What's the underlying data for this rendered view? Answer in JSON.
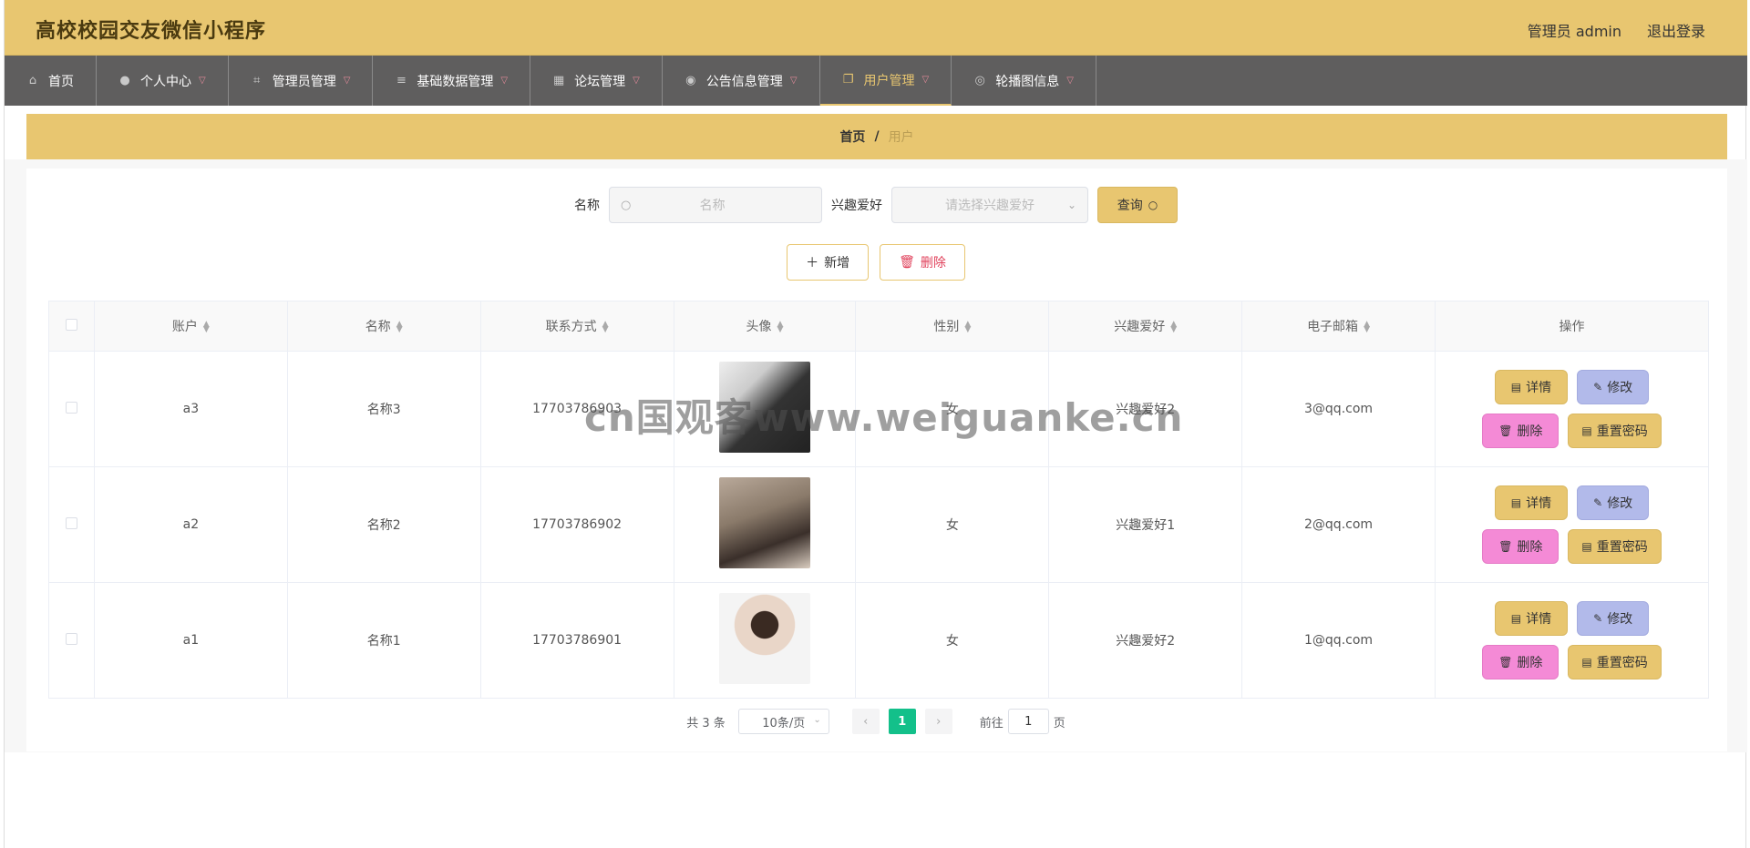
{
  "header": {
    "title": "高校校园交友微信小程序",
    "user": "管理员 admin",
    "logout": "退出登录"
  },
  "nav": [
    {
      "label": "首页",
      "icon": "home-icon",
      "glyph": "⌂"
    },
    {
      "label": "个人中心",
      "icon": "user-icon",
      "glyph": "●"
    },
    {
      "label": "管理员管理",
      "icon": "crop-icon",
      "glyph": "⌗"
    },
    {
      "label": "基础数据管理",
      "icon": "menu-icon",
      "glyph": "≡"
    },
    {
      "label": "论坛管理",
      "icon": "grid-icon",
      "glyph": "▦"
    },
    {
      "label": "公告信息管理",
      "icon": "bulb-icon",
      "glyph": "◉"
    },
    {
      "label": "用户管理",
      "icon": "copy-icon",
      "glyph": "❐"
    },
    {
      "label": "轮播图信息",
      "icon": "compass-icon",
      "glyph": "◎"
    }
  ],
  "breadcrumb": {
    "home": "首页",
    "sep": "/",
    "current": "用户"
  },
  "search": {
    "name_label": "名称",
    "name_placeholder": "名称",
    "hobby_label": "兴趣爱好",
    "hobby_placeholder": "请选择兴趣爱好",
    "query_label": "查询"
  },
  "actions": {
    "add": "新增",
    "delete": "删除"
  },
  "table": {
    "headers": [
      "账户",
      "名称",
      "联系方式",
      "头像",
      "性别",
      "兴趣爱好",
      "电子邮箱",
      "操作"
    ],
    "rows": [
      {
        "account": "a3",
        "name": "名称3",
        "phone": "17703786903",
        "gender": "女",
        "hobby": "兴趣爱好2",
        "email": "3@qq.com"
      },
      {
        "account": "a2",
        "name": "名称2",
        "phone": "17703786902",
        "gender": "女",
        "hobby": "兴趣爱好1",
        "email": "2@qq.com"
      },
      {
        "account": "a1",
        "name": "名称1",
        "phone": "17703786901",
        "gender": "女",
        "hobby": "兴趣爱好2",
        "email": "1@qq.com"
      }
    ],
    "ops": {
      "detail": "详情",
      "edit": "修改",
      "delete": "删除",
      "reset": "重置密码"
    }
  },
  "pagination": {
    "total": "共 3 条",
    "size": "10条/页",
    "current": "1",
    "goto": "前往",
    "jump": "1",
    "page": "页"
  },
  "watermark": "cn国观客www.weiguanke.cn",
  "colors": {
    "accent": "#e8c670",
    "nav_bg": "#5f5e5e",
    "edit": "#b2baea",
    "delete": "#f48ad6",
    "page_active": "#13c08a"
  }
}
